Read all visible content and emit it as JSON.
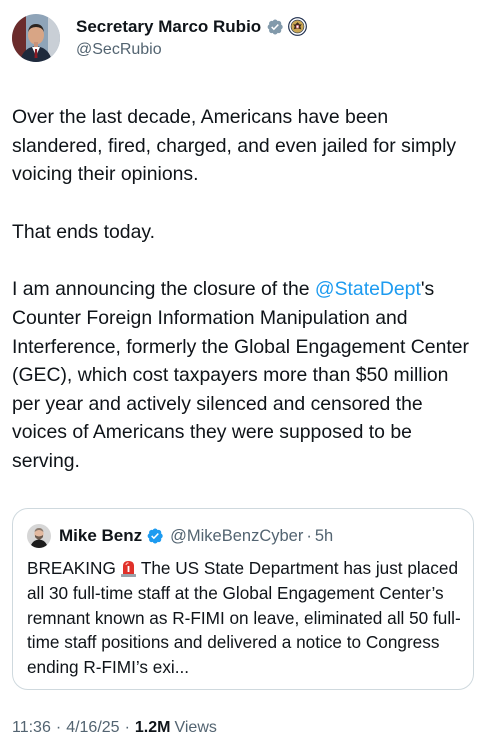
{
  "author": {
    "display_name": "Secretary Marco Rubio",
    "handle": "@SecRubio"
  },
  "tweet": {
    "paragraph_1": "Over the last decade, Americans have been slandered, fired, charged, and even jailed for simply voicing their opinions.",
    "paragraph_2": "That ends today.",
    "paragraph_3_before": "I am announcing the closure of the ",
    "paragraph_3_mention": "@StateDept",
    "paragraph_3_after": "'s Counter Foreign Information Manipulation and Interference, formerly the Global Engagement Center (GEC), which cost taxpayers more than $50 million per year and actively silenced and censored the voices of Americans they were supposed to be serving."
  },
  "quote": {
    "display_name": "Mike Benz",
    "handle": "@MikeBenzCyber",
    "dot": "·",
    "time": "5h",
    "text_prefix": "BREAKING",
    "text_body": "The US State Department has just placed all 30 full-time staff at the Global Engagement Center’s remnant known as R-FIMI on leave, eliminated all 50 full-time staff positions and delivered a notice to Congress ending R-FIMI’s exi..."
  },
  "meta": {
    "time": "11:36",
    "sep": "·",
    "date": "4/16/25",
    "views_count": "1.2M",
    "views_label": "Views"
  },
  "icons": {
    "verified": "verified-badge-icon",
    "seal": "state-department-seal-icon",
    "siren": "rotating-light-emoji"
  },
  "colors": {
    "accent": "#1d9bf0",
    "secondary_text": "#536471",
    "verified_grey": "#829aab",
    "siren_red": "#e0312a"
  }
}
